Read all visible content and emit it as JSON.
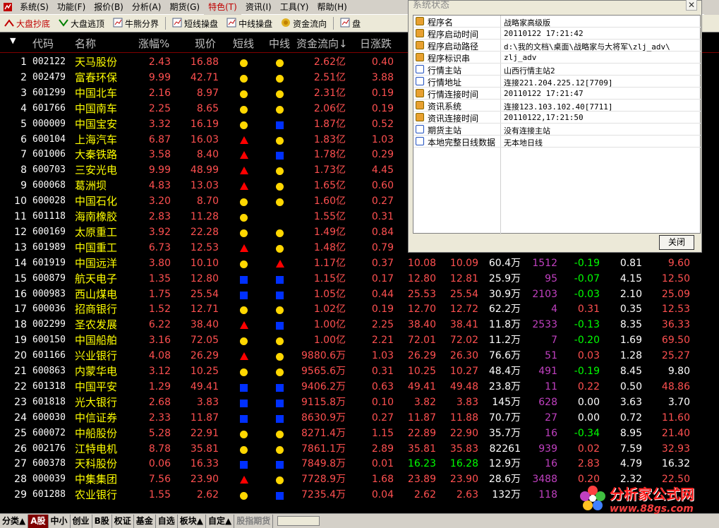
{
  "menu": {
    "items": [
      "系统(S)",
      "功能(F)",
      "报价(B)",
      "分析(A)",
      "期货(G)",
      "特色(T)",
      "资讯(I)",
      "工具(Y)",
      "帮助(H)"
    ],
    "selected_index": 5
  },
  "toolbar": {
    "items": [
      {
        "label": "大盘抄底",
        "icon": "red-arrow-up-icon",
        "style": "red"
      },
      {
        "label": "大盘逃顶",
        "icon": "green-arrow-down-icon",
        "style": "normal"
      },
      {
        "label": "牛熊分界",
        "icon": "chart-icon",
        "style": "normal"
      },
      {
        "label": "短线操盘",
        "icon": "chart-icon",
        "style": "normal"
      },
      {
        "label": "中线操盘",
        "icon": "chart-icon",
        "style": "normal"
      },
      {
        "label": "资金流向",
        "icon": "coin-icon",
        "style": "normal"
      },
      {
        "label": "盘",
        "icon": "chart-icon",
        "style": "normal"
      }
    ]
  },
  "grid": {
    "headers": [
      "代码",
      "名称",
      "涨幅%",
      "现价",
      "短线",
      "中线",
      "资金流向↓",
      "日涨跌"
    ],
    "rows": [
      {
        "idx": "1",
        "code": "002122",
        "name": "天马股份",
        "chg": "2.43",
        "price": "16.88",
        "short": "dot",
        "mid": "dot",
        "flow": "2.62亿",
        "rise": "0.40"
      },
      {
        "idx": "2",
        "code": "002479",
        "name": "富春环保",
        "chg": "9.99",
        "price": "42.71",
        "short": "dot",
        "mid": "dot",
        "flow": "2.51亿",
        "rise": "3.88"
      },
      {
        "idx": "3",
        "code": "601299",
        "name": "中国北车",
        "chg": "2.16",
        "price": "8.97",
        "short": "dot",
        "mid": "dot",
        "flow": "2.31亿",
        "rise": "0.19"
      },
      {
        "idx": "4",
        "code": "601766",
        "name": "中国南车",
        "chg": "2.25",
        "price": "8.65",
        "short": "dot",
        "mid": "dot",
        "flow": "2.06亿",
        "rise": "0.19"
      },
      {
        "idx": "5",
        "code": "000009",
        "name": "中国宝安",
        "chg": "3.32",
        "price": "16.19",
        "short": "dot",
        "mid": "sq",
        "flow": "1.87亿",
        "rise": "0.52"
      },
      {
        "idx": "6",
        "code": "600104",
        "name": "上海汽车",
        "chg": "6.87",
        "price": "16.03",
        "short": "tri",
        "mid": "dot",
        "flow": "1.83亿",
        "rise": "1.03"
      },
      {
        "idx": "7",
        "code": "601006",
        "name": "大秦铁路",
        "chg": "3.58",
        "price": "8.40",
        "short": "tri",
        "mid": "sq",
        "flow": "1.78亿",
        "rise": "0.29"
      },
      {
        "idx": "8",
        "code": "600703",
        "name": "三安光电",
        "chg": "9.99",
        "price": "48.99",
        "short": "tri",
        "mid": "dot",
        "flow": "1.73亿",
        "rise": "4.45"
      },
      {
        "idx": "9",
        "code": "600068",
        "name": "葛洲坝",
        "chg": "4.83",
        "price": "13.03",
        "short": "tri",
        "mid": "dot",
        "flow": "1.65亿",
        "rise": "0.60"
      },
      {
        "idx": "10",
        "code": "600028",
        "name": "中国石化",
        "chg": "3.20",
        "price": "8.70",
        "short": "dot",
        "mid": "dot",
        "flow": "1.60亿",
        "rise": "0.27"
      },
      {
        "idx": "11",
        "code": "601118",
        "name": "海南橡胶",
        "chg": "2.83",
        "price": "11.28",
        "short": "dot",
        "mid": "",
        "flow": "1.55亿",
        "rise": "0.31"
      },
      {
        "idx": "12",
        "code": "600169",
        "name": "太原重工",
        "chg": "3.92",
        "price": "22.28",
        "short": "dot",
        "mid": "dot",
        "flow": "1.49亿",
        "rise": "0.84"
      },
      {
        "idx": "13",
        "code": "601989",
        "name": "中国重工",
        "chg": "6.73",
        "price": "12.53",
        "short": "tri",
        "mid": "dot",
        "flow": "1.48亿",
        "rise": "0.79"
      },
      {
        "idx": "14",
        "code": "601919",
        "name": "中国远洋",
        "chg": "3.80",
        "price": "10.10",
        "short": "dot",
        "mid": "tri",
        "flow": "1.17亿",
        "rise": "0.37",
        "a": "10.08",
        "b": "10.09",
        "vol": "60.4万",
        "x": "1512",
        "y": "-0.19",
        "z": "0.81",
        "w": "9.60"
      },
      {
        "idx": "15",
        "code": "600879",
        "name": "航天电子",
        "chg": "1.35",
        "price": "12.80",
        "short": "sq",
        "mid": "sq",
        "flow": "1.15亿",
        "rise": "0.17",
        "a": "12.80",
        "b": "12.81",
        "vol": "25.9万",
        "x": "95",
        "y": "-0.07",
        "z": "4.15",
        "w": "12.50"
      },
      {
        "idx": "16",
        "code": "000983",
        "name": "西山煤电",
        "chg": "1.75",
        "price": "25.54",
        "short": "sq",
        "mid": "sq",
        "flow": "1.05亿",
        "rise": "0.44",
        "a": "25.53",
        "b": "25.54",
        "vol": "30.9万",
        "x": "2103",
        "y": "-0.03",
        "z": "2.10",
        "w": "25.09"
      },
      {
        "idx": "17",
        "code": "600036",
        "name": "招商银行",
        "chg": "1.52",
        "price": "12.71",
        "short": "dot",
        "mid": "dot",
        "flow": "1.02亿",
        "rise": "0.19",
        "a": "12.70",
        "b": "12.72",
        "vol": "62.2万",
        "x": "4",
        "y": "0.31",
        "z": "0.35",
        "w": "12.53"
      },
      {
        "idx": "18",
        "code": "002299",
        "name": "圣农发展",
        "chg": "6.22",
        "price": "38.40",
        "short": "tri",
        "mid": "sq",
        "flow": "1.00亿",
        "rise": "2.25",
        "a": "38.40",
        "b": "38.41",
        "vol": "11.8万",
        "x": "2533",
        "y": "-0.13",
        "z": "8.35",
        "w": "36.33"
      },
      {
        "idx": "19",
        "code": "600150",
        "name": "中国船舶",
        "chg": "3.16",
        "price": "72.05",
        "short": "dot",
        "mid": "dot",
        "flow": "1.00亿",
        "rise": "2.21",
        "a": "72.01",
        "b": "72.02",
        "vol": "11.2万",
        "x": "7",
        "y": "-0.20",
        "z": "1.69",
        "w": "69.50"
      },
      {
        "idx": "20",
        "code": "601166",
        "name": "兴业银行",
        "chg": "4.08",
        "price": "26.29",
        "short": "tri",
        "mid": "dot",
        "flow": "9880.6万",
        "rise": "1.03",
        "a": "26.29",
        "b": "26.30",
        "vol": "76.6万",
        "x": "51",
        "y": "0.03",
        "z": "1.28",
        "w": "25.27"
      },
      {
        "idx": "21",
        "code": "600863",
        "name": "内蒙华电",
        "chg": "3.12",
        "price": "10.25",
        "short": "dot",
        "mid": "dot",
        "flow": "9565.6万",
        "rise": "0.31",
        "a": "10.25",
        "b": "10.27",
        "vol": "48.4万",
        "x": "491",
        "y": "-0.19",
        "z": "8.45",
        "w": "9.80"
      },
      {
        "idx": "22",
        "code": "601318",
        "name": "中国平安",
        "chg": "1.29",
        "price": "49.41",
        "short": "sq",
        "mid": "sq",
        "flow": "9406.2万",
        "rise": "0.63",
        "a": "49.41",
        "b": "49.48",
        "vol": "23.8万",
        "x": "11",
        "y": "0.22",
        "z": "0.50",
        "w": "48.86"
      },
      {
        "idx": "23",
        "code": "601818",
        "name": "光大银行",
        "chg": "2.68",
        "price": "3.83",
        "short": "sq",
        "mid": "sq",
        "flow": "9115.8万",
        "rise": "0.10",
        "a": "3.82",
        "b": "3.83",
        "vol": "145万",
        "x": "628",
        "y": "0.00",
        "z": "3.63",
        "w": "3.70"
      },
      {
        "idx": "24",
        "code": "600030",
        "name": "中信证券",
        "chg": "2.33",
        "price": "11.87",
        "short": "sq",
        "mid": "sq",
        "flow": "8630.9万",
        "rise": "0.27",
        "a": "11.87",
        "b": "11.88",
        "vol": "70.7万",
        "x": "27",
        "y": "0.00",
        "z": "0.72",
        "w": "11.60"
      },
      {
        "idx": "25",
        "code": "600072",
        "name": "中船股份",
        "chg": "5.28",
        "price": "22.91",
        "short": "dot",
        "mid": "dot",
        "flow": "8271.4万",
        "rise": "1.15",
        "a": "22.89",
        "b": "22.90",
        "vol": "35.7万",
        "x": "16",
        "y": "-0.34",
        "z": "8.95",
        "w": "21.40"
      },
      {
        "idx": "26",
        "code": "002176",
        "name": "江特电机",
        "chg": "8.78",
        "price": "35.81",
        "short": "dot",
        "mid": "dot",
        "flow": "7861.1万",
        "rise": "2.89",
        "a": "35.81",
        "b": "35.83",
        "vol": "82261",
        "x": "939",
        "y": "0.02",
        "z": "7.59",
        "w": "32.93"
      },
      {
        "idx": "27",
        "code": "600378",
        "name": "天科股份",
        "chg": "0.06",
        "price": "16.33",
        "short": "sq",
        "mid": "sq",
        "flow": "7849.8万",
        "rise": "0.01",
        "a": "16.23",
        "b": "16.28",
        "vol": "12.9万",
        "x": "16",
        "y": "2.83",
        "z": "4.79",
        "w": "16.32"
      },
      {
        "idx": "28",
        "code": "000039",
        "name": "中集集团",
        "chg": "7.56",
        "price": "23.90",
        "short": "tri",
        "mid": "dot",
        "flow": "7728.9万",
        "rise": "1.68",
        "a": "23.89",
        "b": "23.90",
        "vol": "28.6万",
        "x": "3488",
        "y": "0.20",
        "z": "2.32",
        "w": "22.50"
      },
      {
        "idx": "29",
        "code": "601288",
        "name": "农业银行",
        "chg": "1.55",
        "price": "2.62",
        "short": "dot",
        "mid": "sq",
        "flow": "7235.4万",
        "rise": "0.04",
        "a": "2.62",
        "b": "2.63",
        "vol": "132万",
        "x": "118",
        "y": "",
        "z": "",
        "w": ""
      }
    ]
  },
  "bottom": {
    "tabs": [
      "分类▲",
      "A股",
      "中小",
      "创业",
      "B股",
      "权证",
      "基金",
      "自选",
      "板块▲",
      "自定▲",
      "股指期货"
    ],
    "active_index": 1
  },
  "dialog": {
    "title": "系统状态",
    "close_button": "关闭",
    "rows": [
      {
        "key": "程序名",
        "value": "战略家高级版",
        "icon": "orange"
      },
      {
        "key": "程序启动时间",
        "value": "20110122 17:21:42",
        "icon": "orange"
      },
      {
        "key": "程序启动路径",
        "value": "d:\\我的文档\\桌面\\战略家与大将军\\zlj_adv\\",
        "icon": "orange"
      },
      {
        "key": "程序标识串",
        "value": "zlj_adv",
        "icon": "orange"
      },
      {
        "key": "行情主站",
        "value": "山西行情主站2",
        "icon": "blue"
      },
      {
        "key": "行情地址",
        "value": "连接221.204.225.12[7709]",
        "icon": "blue"
      },
      {
        "key": "行情连接时间",
        "value": "20110122 17:21:47",
        "icon": "orange"
      },
      {
        "key": "资讯系统",
        "value": "连接123.103.102.40[7711]",
        "icon": "orange"
      },
      {
        "key": "资讯连接时间",
        "value": "20110122,17:21:50",
        "icon": "orange"
      },
      {
        "key": "期货主站",
        "value": "没有连接主站",
        "icon": "blue"
      },
      {
        "key": "本地完整日线数据",
        "value": "无本地日线",
        "icon": "blue"
      }
    ]
  },
  "watermark": {
    "line1": "分析家公式网",
    "line2": "www.88gs.com"
  },
  "colors": {
    "up": "#ff5050",
    "down": "#00ff00",
    "name": "#ffff00",
    "dot": "#ffd700",
    "triangle": "#ff0000",
    "square": "#0030ff",
    "active_tab": "#800000"
  }
}
